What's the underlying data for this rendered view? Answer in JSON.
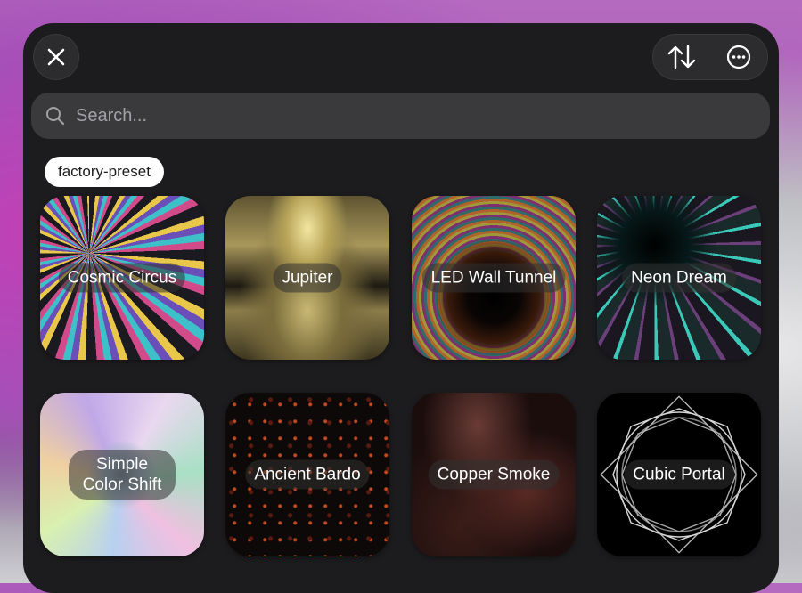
{
  "header": {
    "close_icon": "close-icon",
    "sort_icon": "sort-arrows-icon",
    "more_icon": "ellipsis-circle-icon"
  },
  "search": {
    "placeholder": "Search...",
    "value": ""
  },
  "tag": {
    "label": "factory-preset"
  },
  "presets": [
    {
      "name": "Cosmic Circus"
    },
    {
      "name": "Jupiter"
    },
    {
      "name": "LED Wall Tunnel"
    },
    {
      "name": "Neon Dream"
    },
    {
      "name": "Simple Color Shift"
    },
    {
      "name": "Ancient Bardo"
    },
    {
      "name": "Copper Smoke"
    },
    {
      "name": "Cubic Portal"
    }
  ],
  "colors": {
    "panel": "#1c1c1e",
    "search_bg": "#3a3a3c",
    "tag_bg": "#ffffff"
  }
}
